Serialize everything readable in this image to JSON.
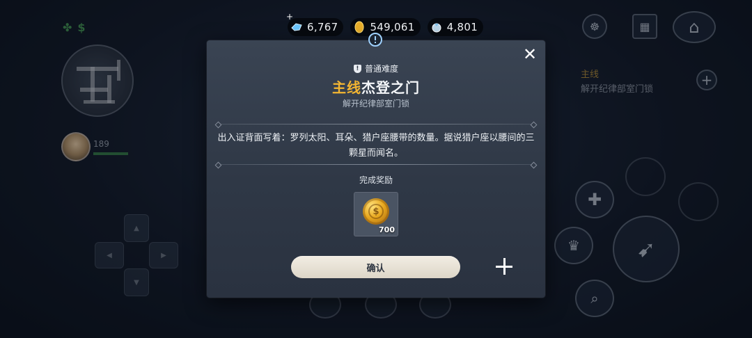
{
  "currencies": [
    {
      "icon": "crystal-icon",
      "value": "6,767"
    },
    {
      "icon": "gold-coin-icon",
      "value": "549,061"
    },
    {
      "icon": "gem-pouch-icon",
      "value": "4,801"
    }
  ],
  "hud": {
    "player_level": "189",
    "quest_side": {
      "title": "主线",
      "subtitle": "解开纪律部室门锁"
    }
  },
  "dialog": {
    "difficulty": "普通难度",
    "quest_type": "主线",
    "quest_name": "杰登之门",
    "subtitle": "解开纪律部室门锁",
    "description": "出入证背面写着：罗列太阳、耳朵、猎户座腰带的数量。据说猎户座以腰间的三颗星而闻名。",
    "reward_label": "完成奖励",
    "reward": {
      "icon": "gold-coin-icon",
      "quantity": "700"
    },
    "confirm_label": "确认",
    "close_icon": "close-icon",
    "add_icon": "plus-icon"
  },
  "colors": {
    "accent_gold": "#f3b532",
    "panel": "#2f3846",
    "button": "#ece6da"
  }
}
